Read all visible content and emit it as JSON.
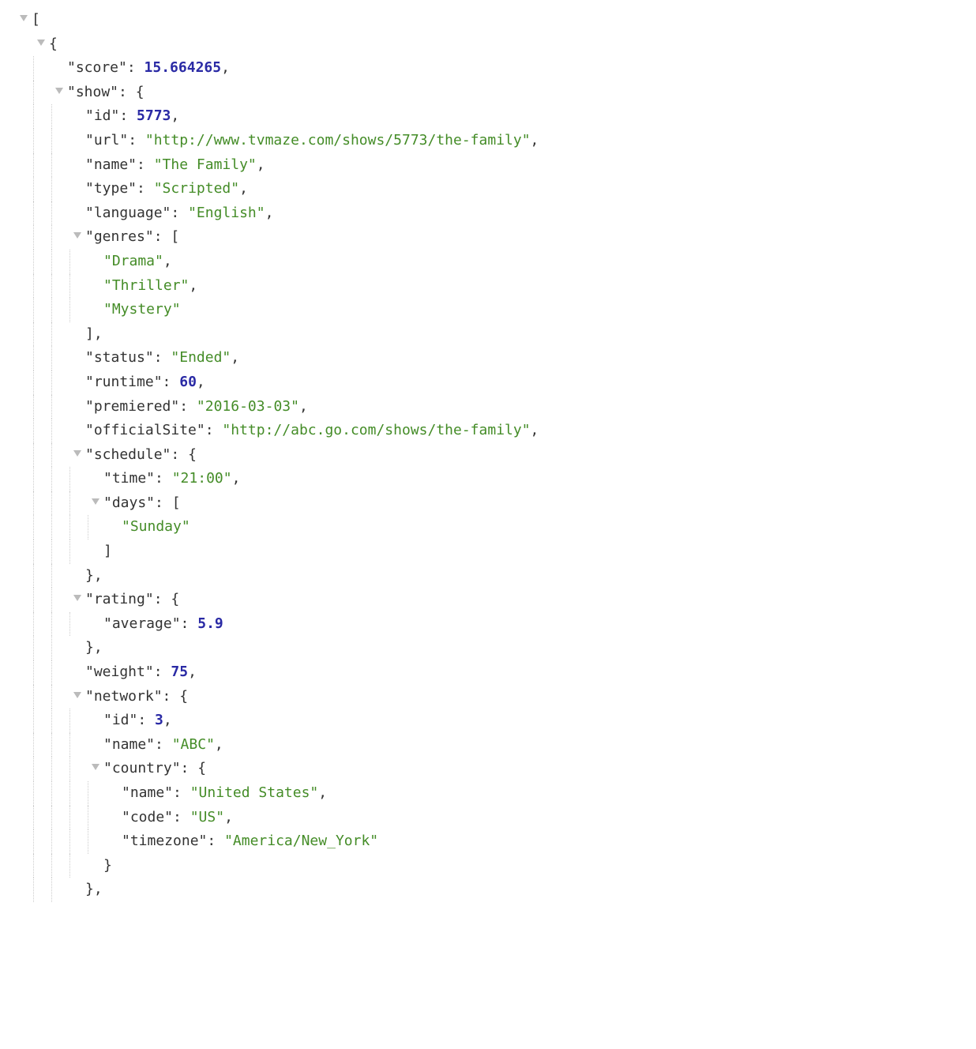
{
  "lines": [
    {
      "indent": 0,
      "toggle": true,
      "content": [
        {
          "t": "bracket",
          "v": "["
        }
      ]
    },
    {
      "indent": 1,
      "toggle": true,
      "content": [
        {
          "t": "bracket",
          "v": "{"
        }
      ]
    },
    {
      "indent": 2,
      "toggle": false,
      "content": [
        {
          "t": "key",
          "v": "\"score\""
        },
        {
          "t": "punct",
          "v": ": "
        },
        {
          "t": "number",
          "v": "15.664265"
        },
        {
          "t": "punct",
          "v": ","
        }
      ]
    },
    {
      "indent": 2,
      "toggle": true,
      "content": [
        {
          "t": "key",
          "v": "\"show\""
        },
        {
          "t": "punct",
          "v": ": "
        },
        {
          "t": "bracket",
          "v": "{"
        }
      ]
    },
    {
      "indent": 3,
      "toggle": false,
      "content": [
        {
          "t": "key",
          "v": "\"id\""
        },
        {
          "t": "punct",
          "v": ": "
        },
        {
          "t": "number",
          "v": "5773"
        },
        {
          "t": "punct",
          "v": ","
        }
      ]
    },
    {
      "indent": 3,
      "toggle": false,
      "content": [
        {
          "t": "key",
          "v": "\"url\""
        },
        {
          "t": "punct",
          "v": ": "
        },
        {
          "t": "string",
          "v": "\"http://www.tvmaze.com/shows/5773/the-family\""
        },
        {
          "t": "punct",
          "v": ","
        }
      ]
    },
    {
      "indent": 3,
      "toggle": false,
      "content": [
        {
          "t": "key",
          "v": "\"name\""
        },
        {
          "t": "punct",
          "v": ": "
        },
        {
          "t": "string",
          "v": "\"The Family\""
        },
        {
          "t": "punct",
          "v": ","
        }
      ]
    },
    {
      "indent": 3,
      "toggle": false,
      "content": [
        {
          "t": "key",
          "v": "\"type\""
        },
        {
          "t": "punct",
          "v": ": "
        },
        {
          "t": "string",
          "v": "\"Scripted\""
        },
        {
          "t": "punct",
          "v": ","
        }
      ]
    },
    {
      "indent": 3,
      "toggle": false,
      "content": [
        {
          "t": "key",
          "v": "\"language\""
        },
        {
          "t": "punct",
          "v": ": "
        },
        {
          "t": "string",
          "v": "\"English\""
        },
        {
          "t": "punct",
          "v": ","
        }
      ]
    },
    {
      "indent": 3,
      "toggle": true,
      "content": [
        {
          "t": "key",
          "v": "\"genres\""
        },
        {
          "t": "punct",
          "v": ": "
        },
        {
          "t": "bracket",
          "v": "["
        }
      ]
    },
    {
      "indent": 4,
      "toggle": false,
      "content": [
        {
          "t": "string",
          "v": "\"Drama\""
        },
        {
          "t": "punct",
          "v": ","
        }
      ]
    },
    {
      "indent": 4,
      "toggle": false,
      "content": [
        {
          "t": "string",
          "v": "\"Thriller\""
        },
        {
          "t": "punct",
          "v": ","
        }
      ]
    },
    {
      "indent": 4,
      "toggle": false,
      "content": [
        {
          "t": "string",
          "v": "\"Mystery\""
        }
      ]
    },
    {
      "indent": 3,
      "toggle": false,
      "noSpacer": true,
      "content": [
        {
          "t": "bracket",
          "v": "]"
        },
        {
          "t": "punct",
          "v": ","
        }
      ]
    },
    {
      "indent": 3,
      "toggle": false,
      "content": [
        {
          "t": "key",
          "v": "\"status\""
        },
        {
          "t": "punct",
          "v": ": "
        },
        {
          "t": "string",
          "v": "\"Ended\""
        },
        {
          "t": "punct",
          "v": ","
        }
      ]
    },
    {
      "indent": 3,
      "toggle": false,
      "content": [
        {
          "t": "key",
          "v": "\"runtime\""
        },
        {
          "t": "punct",
          "v": ": "
        },
        {
          "t": "number",
          "v": "60"
        },
        {
          "t": "punct",
          "v": ","
        }
      ]
    },
    {
      "indent": 3,
      "toggle": false,
      "content": [
        {
          "t": "key",
          "v": "\"premiered\""
        },
        {
          "t": "punct",
          "v": ": "
        },
        {
          "t": "string",
          "v": "\"2016-03-03\""
        },
        {
          "t": "punct",
          "v": ","
        }
      ]
    },
    {
      "indent": 3,
      "toggle": false,
      "content": [
        {
          "t": "key",
          "v": "\"officialSite\""
        },
        {
          "t": "punct",
          "v": ": "
        },
        {
          "t": "string",
          "v": "\"http://abc.go.com/shows/the-family\""
        },
        {
          "t": "punct",
          "v": ","
        }
      ]
    },
    {
      "indent": 3,
      "toggle": true,
      "content": [
        {
          "t": "key",
          "v": "\"schedule\""
        },
        {
          "t": "punct",
          "v": ": "
        },
        {
          "t": "bracket",
          "v": "{"
        }
      ]
    },
    {
      "indent": 4,
      "toggle": false,
      "content": [
        {
          "t": "key",
          "v": "\"time\""
        },
        {
          "t": "punct",
          "v": ": "
        },
        {
          "t": "string",
          "v": "\"21:00\""
        },
        {
          "t": "punct",
          "v": ","
        }
      ]
    },
    {
      "indent": 4,
      "toggle": true,
      "content": [
        {
          "t": "key",
          "v": "\"days\""
        },
        {
          "t": "punct",
          "v": ": "
        },
        {
          "t": "bracket",
          "v": "["
        }
      ]
    },
    {
      "indent": 5,
      "toggle": false,
      "content": [
        {
          "t": "string",
          "v": "\"Sunday\""
        }
      ]
    },
    {
      "indent": 4,
      "toggle": false,
      "noSpacer": true,
      "content": [
        {
          "t": "bracket",
          "v": "]"
        }
      ]
    },
    {
      "indent": 3,
      "toggle": false,
      "noSpacer": true,
      "content": [
        {
          "t": "bracket",
          "v": "}"
        },
        {
          "t": "punct",
          "v": ","
        }
      ]
    },
    {
      "indent": 3,
      "toggle": true,
      "content": [
        {
          "t": "key",
          "v": "\"rating\""
        },
        {
          "t": "punct",
          "v": ": "
        },
        {
          "t": "bracket",
          "v": "{"
        }
      ]
    },
    {
      "indent": 4,
      "toggle": false,
      "content": [
        {
          "t": "key",
          "v": "\"average\""
        },
        {
          "t": "punct",
          "v": ": "
        },
        {
          "t": "number",
          "v": "5.9"
        }
      ]
    },
    {
      "indent": 3,
      "toggle": false,
      "noSpacer": true,
      "content": [
        {
          "t": "bracket",
          "v": "}"
        },
        {
          "t": "punct",
          "v": ","
        }
      ]
    },
    {
      "indent": 3,
      "toggle": false,
      "content": [
        {
          "t": "key",
          "v": "\"weight\""
        },
        {
          "t": "punct",
          "v": ": "
        },
        {
          "t": "number",
          "v": "75"
        },
        {
          "t": "punct",
          "v": ","
        }
      ]
    },
    {
      "indent": 3,
      "toggle": true,
      "content": [
        {
          "t": "key",
          "v": "\"network\""
        },
        {
          "t": "punct",
          "v": ": "
        },
        {
          "t": "bracket",
          "v": "{"
        }
      ]
    },
    {
      "indent": 4,
      "toggle": false,
      "content": [
        {
          "t": "key",
          "v": "\"id\""
        },
        {
          "t": "punct",
          "v": ": "
        },
        {
          "t": "number",
          "v": "3"
        },
        {
          "t": "punct",
          "v": ","
        }
      ]
    },
    {
      "indent": 4,
      "toggle": false,
      "content": [
        {
          "t": "key",
          "v": "\"name\""
        },
        {
          "t": "punct",
          "v": ": "
        },
        {
          "t": "string",
          "v": "\"ABC\""
        },
        {
          "t": "punct",
          "v": ","
        }
      ]
    },
    {
      "indent": 4,
      "toggle": true,
      "content": [
        {
          "t": "key",
          "v": "\"country\""
        },
        {
          "t": "punct",
          "v": ": "
        },
        {
          "t": "bracket",
          "v": "{"
        }
      ]
    },
    {
      "indent": 5,
      "toggle": false,
      "content": [
        {
          "t": "key",
          "v": "\"name\""
        },
        {
          "t": "punct",
          "v": ": "
        },
        {
          "t": "string",
          "v": "\"United States\""
        },
        {
          "t": "punct",
          "v": ","
        }
      ]
    },
    {
      "indent": 5,
      "toggle": false,
      "content": [
        {
          "t": "key",
          "v": "\"code\""
        },
        {
          "t": "punct",
          "v": ": "
        },
        {
          "t": "string",
          "v": "\"US\""
        },
        {
          "t": "punct",
          "v": ","
        }
      ]
    },
    {
      "indent": 5,
      "toggle": false,
      "content": [
        {
          "t": "key",
          "v": "\"timezone\""
        },
        {
          "t": "punct",
          "v": ": "
        },
        {
          "t": "string",
          "v": "\"America/New_York\""
        }
      ]
    },
    {
      "indent": 4,
      "toggle": false,
      "noSpacer": true,
      "content": [
        {
          "t": "bracket",
          "v": "}"
        }
      ]
    },
    {
      "indent": 3,
      "toggle": false,
      "noSpacer": true,
      "content": [
        {
          "t": "bracket",
          "v": "}"
        },
        {
          "t": "punct",
          "v": ","
        }
      ]
    }
  ]
}
